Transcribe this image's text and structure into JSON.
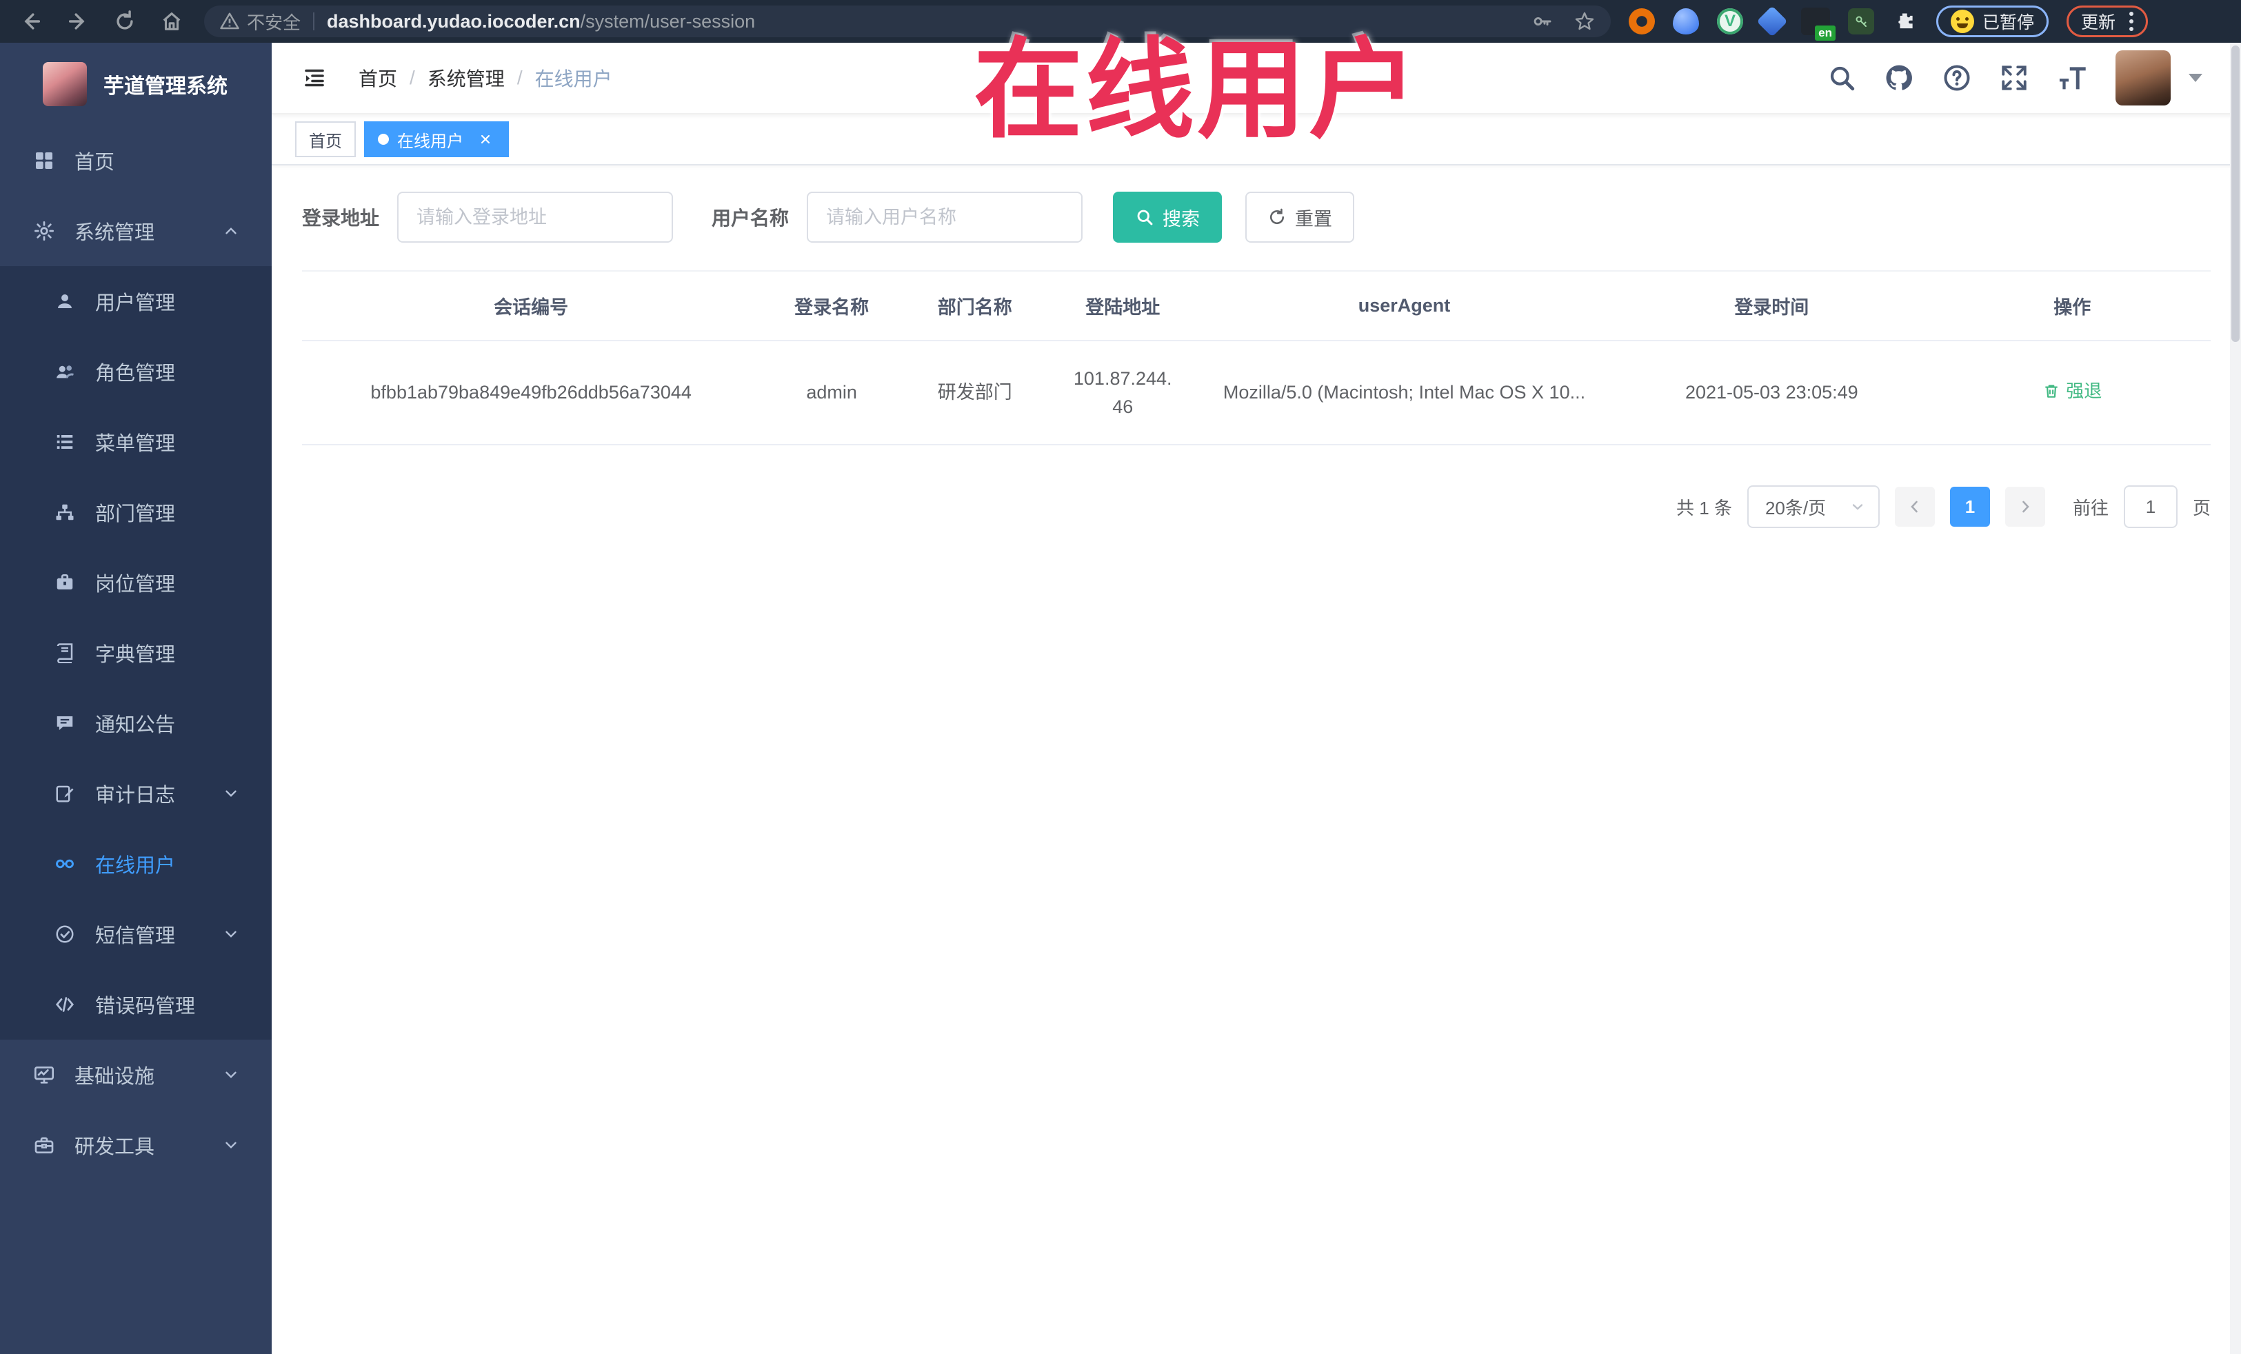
{
  "browser": {
    "security_label": "不安全",
    "url_host": "dashboard.yudao.iocoder.cn",
    "url_path": "/system/user-session",
    "profile_status": "已暂停",
    "update_label": "更新",
    "ext_en_badge": "en",
    "vue_badge": "V"
  },
  "sidebar": {
    "title": "芋道管理系统",
    "items": [
      {
        "label": "首页"
      },
      {
        "label": "系统管理"
      },
      {
        "label": "用户管理"
      },
      {
        "label": "角色管理"
      },
      {
        "label": "菜单管理"
      },
      {
        "label": "部门管理"
      },
      {
        "label": "岗位管理"
      },
      {
        "label": "字典管理"
      },
      {
        "label": "通知公告"
      },
      {
        "label": "审计日志"
      },
      {
        "label": "在线用户"
      },
      {
        "label": "短信管理"
      },
      {
        "label": "错误码管理"
      },
      {
        "label": "基础设施"
      },
      {
        "label": "研发工具"
      }
    ]
  },
  "navbar": {
    "breadcrumb": [
      "首页",
      "系统管理",
      "在线用户"
    ],
    "breadcrumb_sep": "/"
  },
  "tags": {
    "home": "首页",
    "active": "在线用户"
  },
  "filter": {
    "address_label": "登录地址",
    "address_placeholder": "请输入登录地址",
    "username_label": "用户名称",
    "username_placeholder": "请输入用户名称",
    "search_label": "搜索",
    "reset_label": "重置"
  },
  "table": {
    "columns": [
      "会话编号",
      "登录名称",
      "部门名称",
      "登陆地址",
      "userAgent",
      "登录时间",
      "操作"
    ],
    "row": {
      "session_id": "bfbb1ab79ba849e49fb26ddb56a73044",
      "login_name": "admin",
      "dept_name": "研发部门",
      "ip_line1": "101.87.244.",
      "ip_line2": "46",
      "user_agent": "Mozilla/5.0 (Macintosh; Intel Mac OS X 10...",
      "login_time": "2021-05-03 23:05:49",
      "action": "强退"
    }
  },
  "pagination": {
    "total": "共 1 条",
    "page_size": "20条/页",
    "current_page": "1",
    "goto_label": "前往",
    "goto_value": "1",
    "page_unit": "页"
  },
  "annotation": {
    "text": "在线用户"
  },
  "colors": {
    "accent": "#409eff",
    "search_teal": "#2cbca3",
    "action_green": "#42b983",
    "annotation_red": "#e93157",
    "sidebar_bg": "#31405f",
    "sidebar_sub_bg": "#263450",
    "toolbar_bg": "#202b3a"
  }
}
